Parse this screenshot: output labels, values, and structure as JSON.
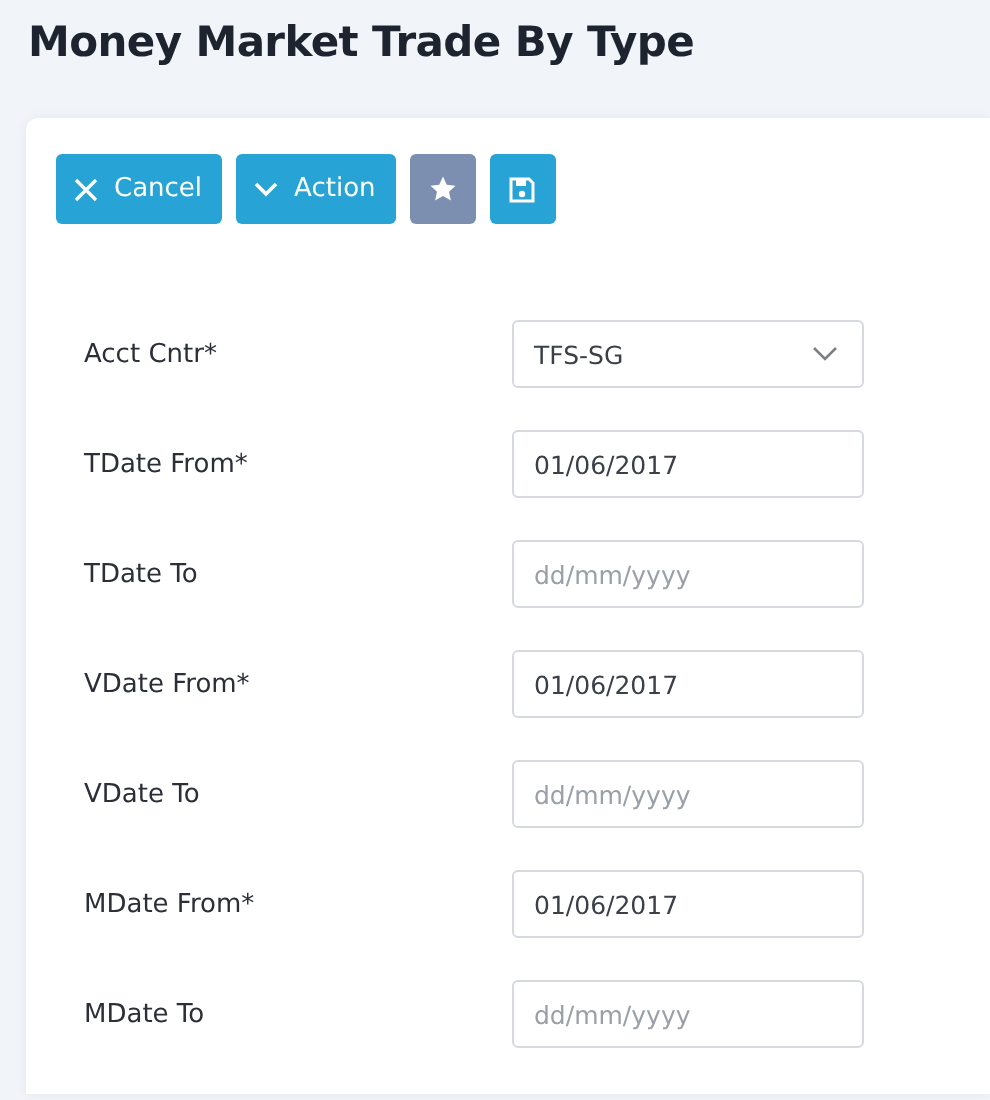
{
  "page_title": "Money Market Trade By Type",
  "toolbar": [
    {
      "kind": "cancel",
      "label": "Cancel"
    },
    {
      "kind": "action",
      "label": "Action"
    },
    {
      "kind": "favorite"
    },
    {
      "kind": "save"
    }
  ],
  "fields": [
    {
      "label": "Acct Cntr*",
      "kind": "select",
      "value": "TFS-SG"
    },
    {
      "label": "TDate From*",
      "kind": "date",
      "value": "01/06/2017"
    },
    {
      "label": "TDate To",
      "kind": "date",
      "placeholder": "dd/mm/yyyy"
    },
    {
      "label": "VDate From*",
      "kind": "date",
      "value": "01/06/2017"
    },
    {
      "label": "VDate To",
      "kind": "date",
      "placeholder": "dd/mm/yyyy"
    },
    {
      "label": "MDate From*",
      "kind": "date",
      "value": "01/06/2017"
    },
    {
      "label": "MDate To",
      "kind": "date",
      "placeholder": "dd/mm/yyyy"
    }
  ]
}
